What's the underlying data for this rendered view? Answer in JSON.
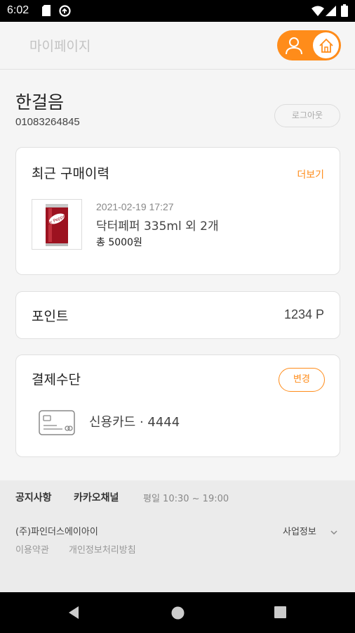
{
  "status_bar": {
    "time": "6:02"
  },
  "header": {
    "title": "마이페이지"
  },
  "profile": {
    "name": "한걸음",
    "phone": "01083264845",
    "logout_label": "로그아웃"
  },
  "recent_purchase": {
    "title": "최근 구매이력",
    "more_label": "더보기",
    "item": {
      "date": "2021-02-19 17:27",
      "name": "닥터페퍼 335ml 외 2개",
      "total": "총 5000원",
      "image": "dr-pepper-can"
    }
  },
  "points": {
    "label": "포인트",
    "value": "1234 P"
  },
  "payment": {
    "title": "결제수단",
    "change_label": "변경",
    "method": "신용카드 · 4444"
  },
  "footer": {
    "notice": "공지사항",
    "kakao": "카카오채널",
    "hours": "평일 10:30 ~ 19:00",
    "company": "(주)파인더스에이아이",
    "business_info": "사업정보",
    "terms": "이용약관",
    "privacy": "개인정보처리방침"
  },
  "colors": {
    "accent": "#ff8c1a",
    "background": "#f5f5f5",
    "card": "#ffffff"
  }
}
